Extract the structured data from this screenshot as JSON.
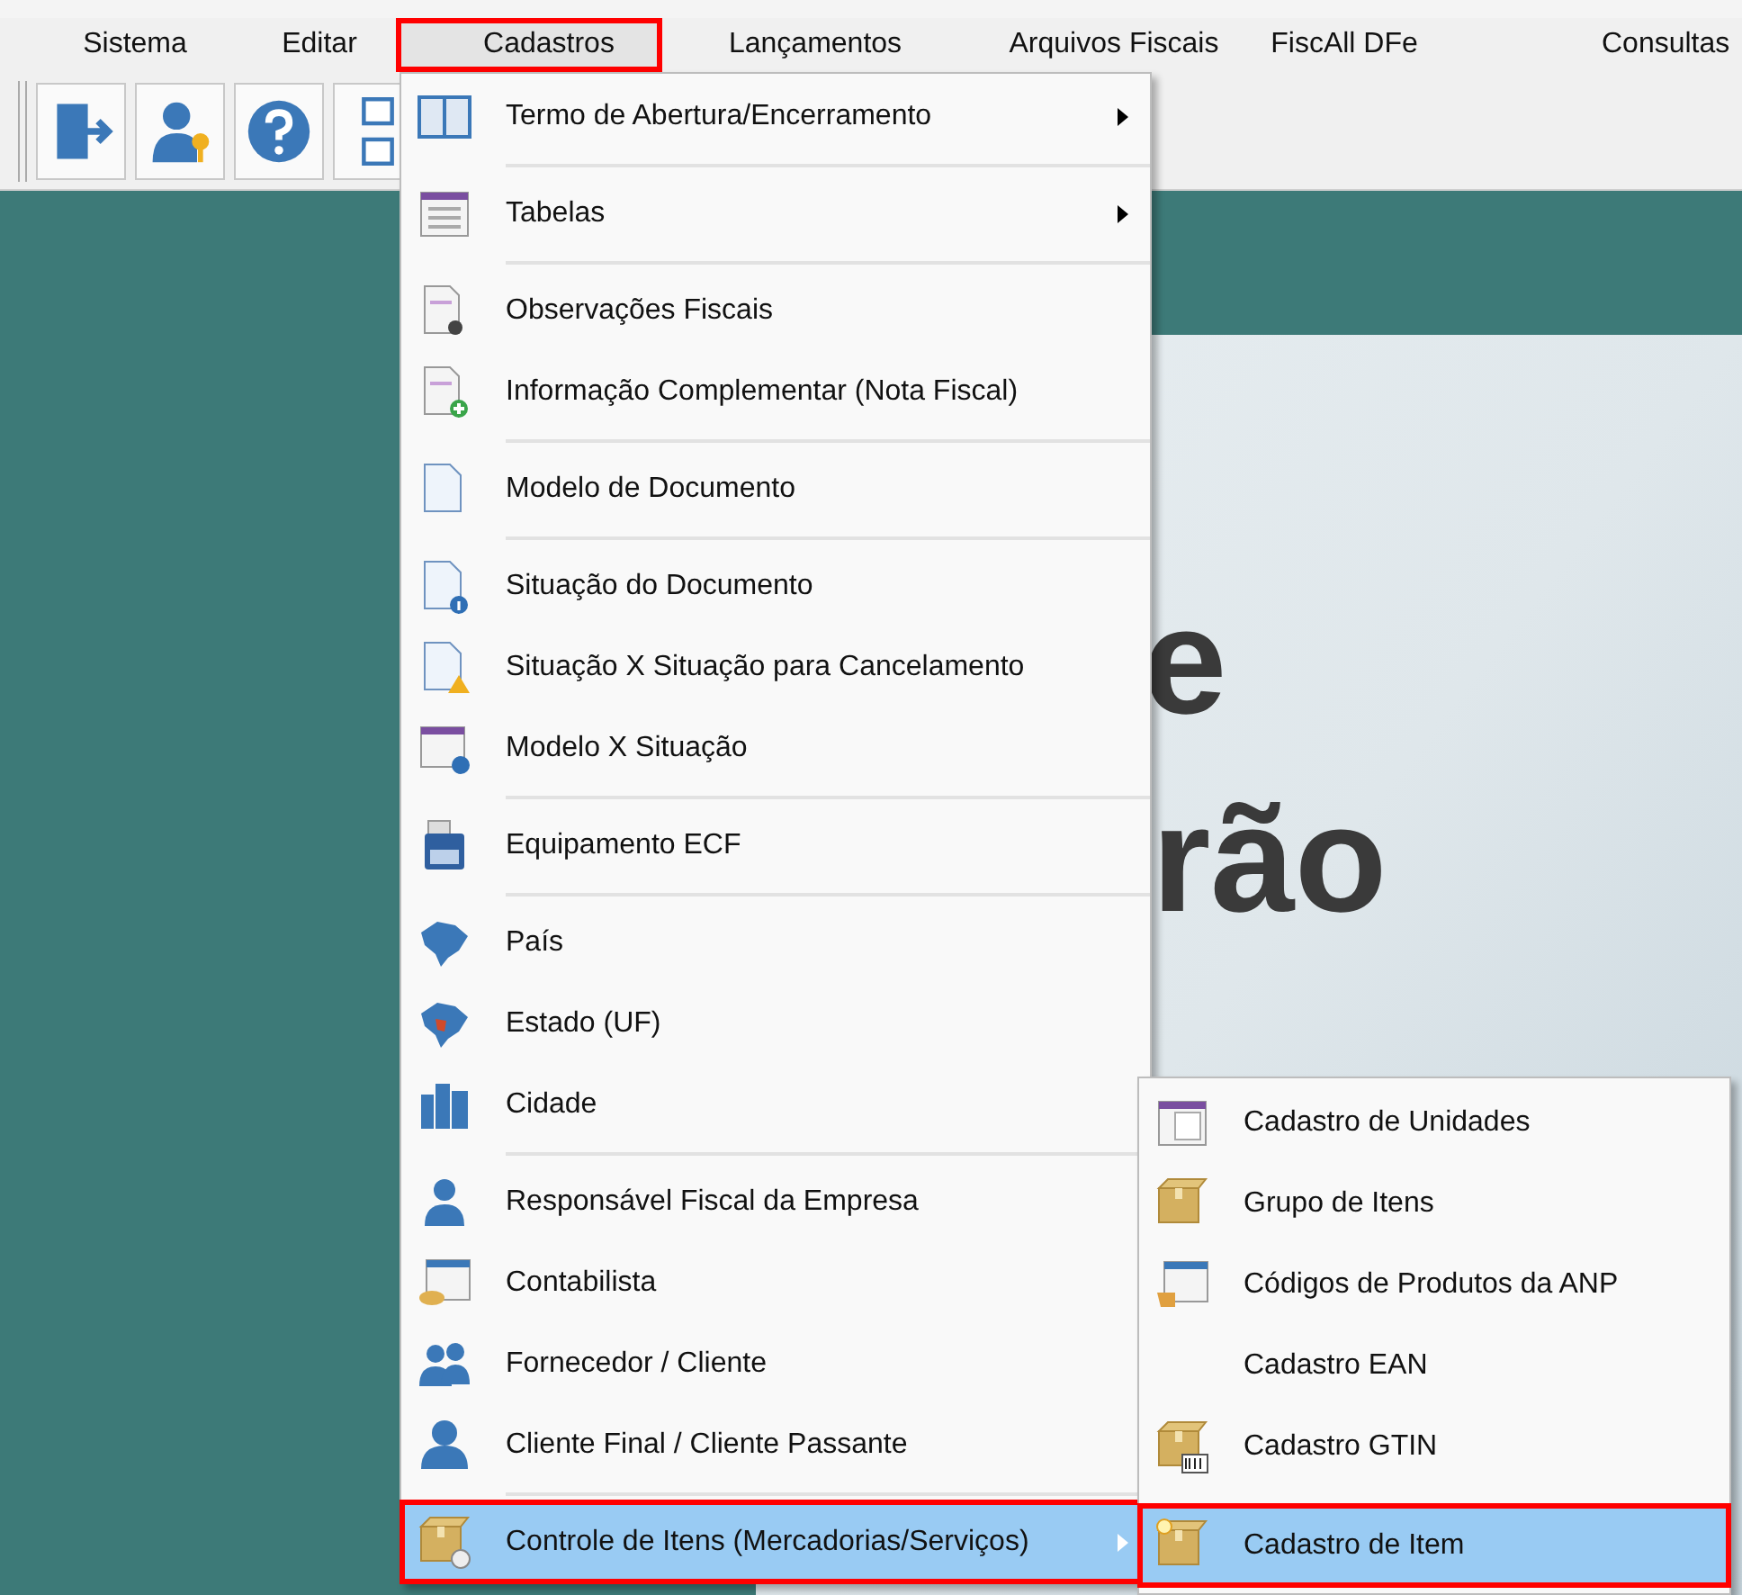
{
  "menu_bar": [
    {
      "label": "Sistema",
      "selected": false,
      "marked": false
    },
    {
      "label": "Editar",
      "selected": false,
      "marked": false
    },
    {
      "label": "Cadastros",
      "selected": true,
      "marked": true
    },
    {
      "label": "Lançamentos",
      "selected": false,
      "marked": false
    },
    {
      "label": "Arquivos Fiscais",
      "selected": false,
      "marked": false
    },
    {
      "label": "FiscAll DFe",
      "selected": false,
      "marked": false
    },
    {
      "label": "Consultas",
      "selected": false,
      "marked": false
    }
  ],
  "banner": {
    "lines": [
      "e",
      "rão"
    ]
  },
  "menu": {
    "items": [
      {
        "label": "Termo de Abertura/Encerramento",
        "submenu": true,
        "separator_after": true,
        "selected": false,
        "marked": false
      },
      {
        "label": "Tabelas",
        "submenu": true,
        "separator_after": true,
        "selected": false,
        "marked": false
      },
      {
        "label": "Observações Fiscais",
        "submenu": false,
        "separator_after": false,
        "selected": false,
        "marked": false
      },
      {
        "label": "Informação Complementar (Nota Fiscal)",
        "submenu": false,
        "separator_after": true,
        "selected": false,
        "marked": false
      },
      {
        "label": "Modelo de Documento",
        "submenu": false,
        "separator_after": true,
        "selected": false,
        "marked": false
      },
      {
        "label": "Situação do Documento",
        "submenu": false,
        "separator_after": false,
        "selected": false,
        "marked": false
      },
      {
        "label": "Situação X Situação para Cancelamento",
        "submenu": false,
        "separator_after": false,
        "selected": false,
        "marked": false
      },
      {
        "label": "Modelo X Situação",
        "submenu": false,
        "separator_after": true,
        "selected": false,
        "marked": false
      },
      {
        "label": "Equipamento ECF",
        "submenu": false,
        "separator_after": true,
        "selected": false,
        "marked": false
      },
      {
        "label": "País",
        "submenu": false,
        "separator_after": false,
        "selected": false,
        "marked": false
      },
      {
        "label": "Estado (UF)",
        "submenu": false,
        "separator_after": false,
        "selected": false,
        "marked": false
      },
      {
        "label": "Cidade",
        "submenu": false,
        "separator_after": true,
        "selected": false,
        "marked": false
      },
      {
        "label": "Responsável Fiscal da Empresa",
        "submenu": false,
        "separator_after": false,
        "selected": false,
        "marked": false
      },
      {
        "label": "Contabilista",
        "submenu": false,
        "separator_after": false,
        "selected": false,
        "marked": false
      },
      {
        "label": "Fornecedor / Cliente",
        "submenu": false,
        "separator_after": false,
        "selected": false,
        "marked": false
      },
      {
        "label": "Cliente Final / Cliente Passante",
        "submenu": false,
        "separator_after": true,
        "selected": false,
        "marked": false
      },
      {
        "label": "Controle de Itens (Mercadorias/Serviços)",
        "submenu": true,
        "separator_after": false,
        "selected": true,
        "marked": true
      }
    ]
  },
  "submenu": {
    "items": [
      {
        "label": "Cadastro de Unidades",
        "selected": false,
        "marked": false
      },
      {
        "label": "Grupo de Itens",
        "selected": false,
        "marked": false
      },
      {
        "label": "Códigos de Produtos da ANP",
        "selected": false,
        "marked": false
      },
      {
        "label": "Cadastro EAN",
        "selected": false,
        "marked": false
      },
      {
        "label": "Cadastro GTIN",
        "selected": false,
        "marked": false
      },
      {
        "label": "Cadastro de Item",
        "selected": true,
        "marked": true
      }
    ]
  }
}
